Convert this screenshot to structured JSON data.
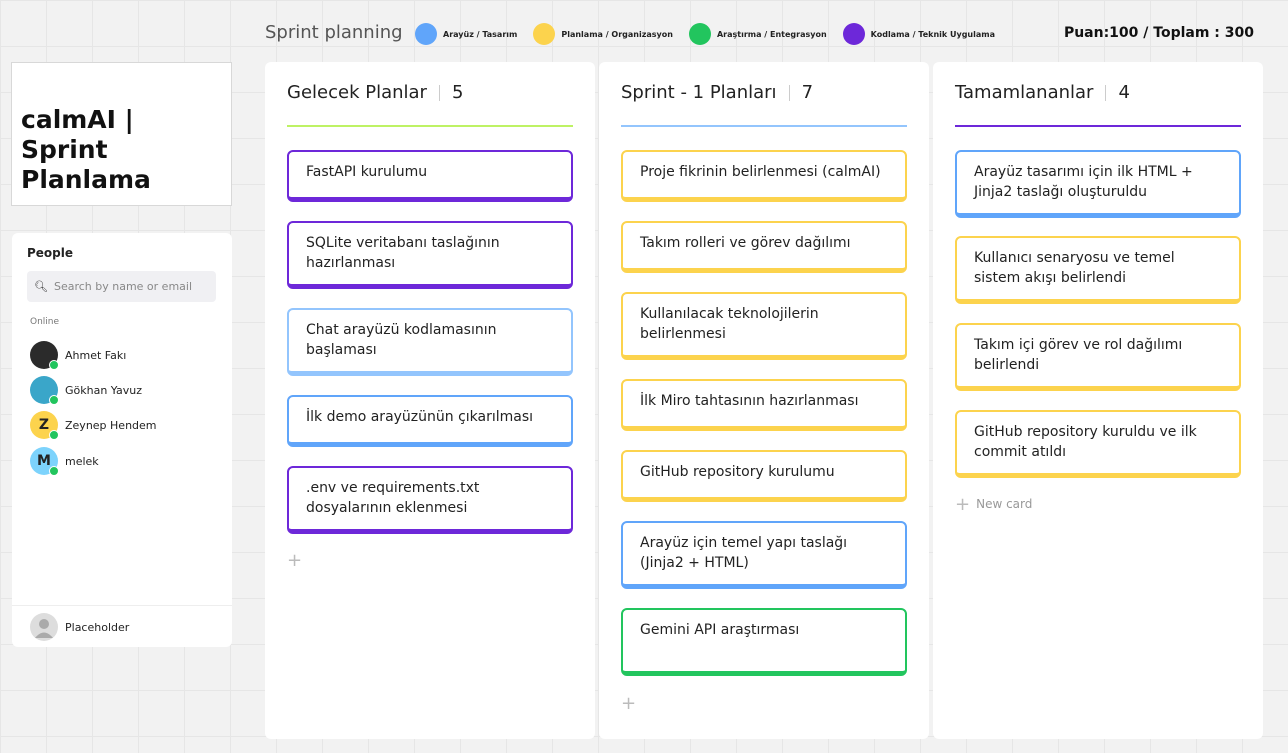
{
  "header": {
    "title": "Sprint planning",
    "legend": [
      {
        "label": "Arayüz / Tasarım",
        "color": "#60a5fa"
      },
      {
        "label": "Planlama / Organizasyon",
        "color": "#fcd34d"
      },
      {
        "label": "Araştırma / Entegrasyon",
        "color": "#22c55e"
      },
      {
        "label": "Kodlama / Teknik Uygulama",
        "color": "#6d28d9"
      }
    ],
    "score": "Puan:100 / Toplam : 300"
  },
  "board_title": "calmAI | Sprint Planlama",
  "people": {
    "title": "People",
    "search_placeholder": "Search by name or email",
    "online_label": "Online",
    "users": [
      {
        "name": "Ahmet Fakı",
        "initial": "",
        "color": "#2b2b2b"
      },
      {
        "name": "Gökhan Yavuz",
        "initial": "",
        "color": "#3aa6c9"
      },
      {
        "name": "Zeynep Hendem",
        "initial": "Z",
        "color": "#fcd34d"
      },
      {
        "name": "melek",
        "initial": "M",
        "color": "#7dd3fc"
      }
    ],
    "placeholder_user": "Placeholder"
  },
  "columns": [
    {
      "title": "Gelecek Planlar",
      "count": "5",
      "line_color": "#bef264",
      "cards": [
        {
          "text": "FastAPI kurulumu",
          "color": "#6d28d9"
        },
        {
          "text": "SQLite veritabanı taslağının hazırlanması",
          "color": "#6d28d9"
        },
        {
          "text": "Chat arayüzü kodlamasının başlaması",
          "color": "#93c5fd"
        },
        {
          "text": "İlk demo arayüzünün çıkarılması",
          "color": "#60a5fa"
        },
        {
          "text": ".env ve requirements.txt dosyalarının eklenmesi",
          "color": "#6d28d9"
        }
      ],
      "add_label": ""
    },
    {
      "title": "Sprint - 1 Planları",
      "count": "7",
      "line_color": "#93c5fd",
      "cards": [
        {
          "text": "Proje fikrinin belirlenmesi (calmAI)",
          "color": "#fcd34d"
        },
        {
          "text": "Takım rolleri ve görev dağılımı",
          "color": "#fcd34d"
        },
        {
          "text": "Kullanılacak teknolojilerin belirlenmesi",
          "color": "#fcd34d"
        },
        {
          "text": "İlk Miro tahtasının hazırlanması",
          "color": "#fcd34d"
        },
        {
          "text": "GitHub repository kurulumu",
          "color": "#fcd34d"
        },
        {
          "text": "Arayüz için temel yapı taslağı (Jinja2 + HTML)",
          "color": "#60a5fa"
        },
        {
          "text": "Gemini API araştırması",
          "color": "#22c55e"
        }
      ],
      "add_label": ""
    },
    {
      "title": "Tamamlananlar",
      "count": "4",
      "line_color": "#6d28d9",
      "cards": [
        {
          "text": "Arayüz tasarımı için ilk HTML + Jinja2 taslağı oluşturuldu",
          "color": "#60a5fa"
        },
        {
          "text": "Kullanıcı senaryosu ve temel sistem akışı belirlendi",
          "color": "#fcd34d"
        },
        {
          "text": "Takım içi görev ve rol dağılımı belirlendi",
          "color": "#fcd34d"
        },
        {
          "text": "GitHub repository kuruldu ve ilk commit atıldı",
          "color": "#fcd34d"
        }
      ],
      "add_label": "New card"
    }
  ]
}
